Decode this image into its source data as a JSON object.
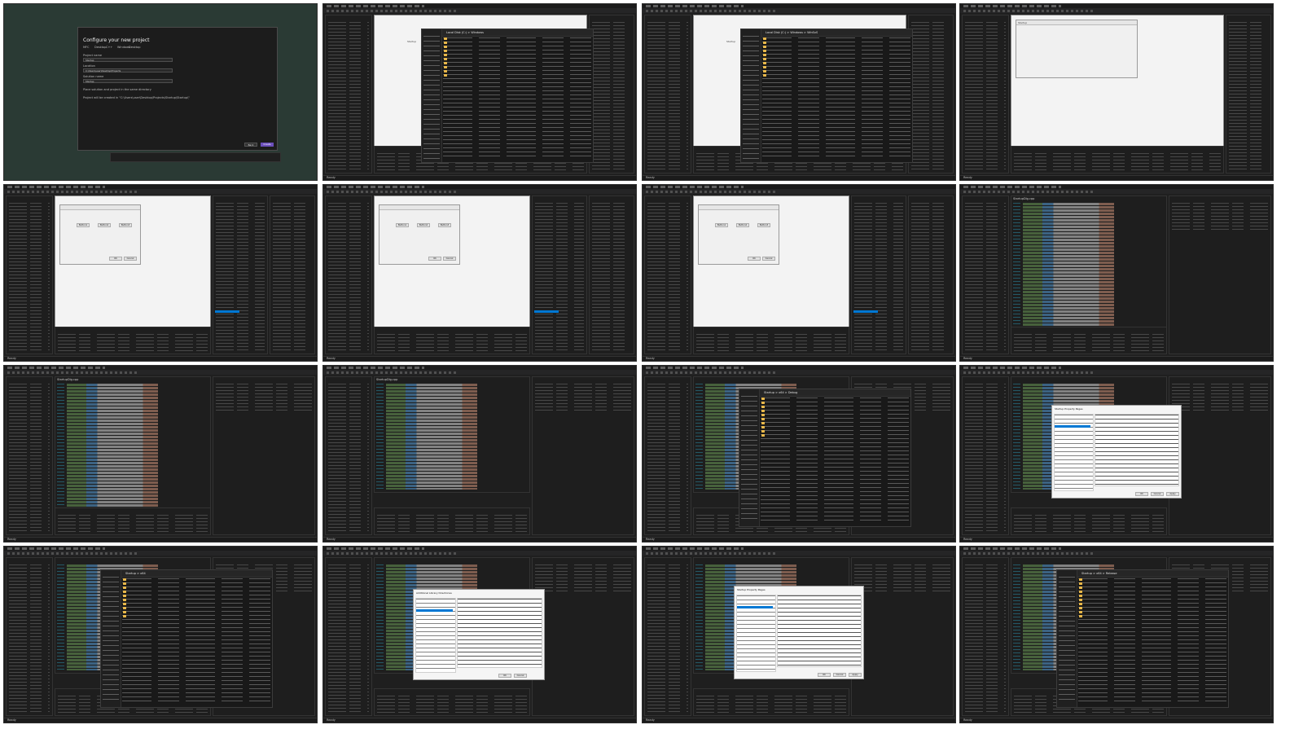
{
  "frames": [
    {
      "kind": "new-project",
      "dialog_title": "Configure your new project",
      "tags": [
        "MFC",
        "Desktop",
        "C++",
        "Windows",
        "Desktop"
      ],
      "fields": [
        {
          "label": "Project name",
          "value": "Startup"
        },
        {
          "label": "Location",
          "value": "C:\\Users\\user\\Desktop\\Projects"
        },
        {
          "label": "Solution name",
          "value": "Startup"
        }
      ],
      "checkbox": "Place solution and project in the same directory",
      "note": "Project will be created in \"C:\\Users\\user\\Desktop\\Projects\\Startup\\Startup\\\"",
      "back_label": "Back",
      "create_label": "Create"
    },
    {
      "kind": "vs-explorer",
      "status": "Ready",
      "explorer_path": "Local Disk (C:) > Windows"
    },
    {
      "kind": "vs-explorer",
      "status": "Ready",
      "explorer_path": "Local Disk (C:) > Windows > WinSxS"
    },
    {
      "kind": "vs-designer",
      "status": "Ready",
      "dialog_caption": "Startup"
    },
    {
      "kind": "vs-designer-props",
      "status": "Ready",
      "buttons": [
        "Button1",
        "Button2",
        "Button3"
      ],
      "ok": "OK",
      "cancel": "Cancel"
    },
    {
      "kind": "vs-designer-props",
      "status": "Ready",
      "buttons": [
        "Button1",
        "Button2",
        "Button3"
      ],
      "ok": "OK",
      "cancel": "Cancel"
    },
    {
      "kind": "vs-designer-props",
      "status": "Ready",
      "buttons": [
        "Button1",
        "Button2",
        "Button3"
      ],
      "ok": "OK",
      "cancel": "Cancel"
    },
    {
      "kind": "vs-code",
      "status": "Ready",
      "tab": "StartupDlg.cpp"
    },
    {
      "kind": "vs-code",
      "status": "Ready",
      "tab": "StartupDlg.cpp"
    },
    {
      "kind": "vs-code-output",
      "status": "Ready",
      "tab": "StartupDlg.cpp"
    },
    {
      "kind": "vs-explorer-code",
      "status": "Ready",
      "explorer_path": "Startup > x64 > Debug"
    },
    {
      "kind": "vs-property-pages",
      "status": "Ready",
      "dialog_title": "Startup Property Pages",
      "ok": "OK",
      "cancel": "Cancel",
      "apply": "Apply"
    },
    {
      "kind": "vs-explorer-code",
      "status": "Ready",
      "explorer_path": "Startup > x64"
    },
    {
      "kind": "vs-property-sheet",
      "status": "Ready",
      "dialog_title": "Additional Library Directories",
      "ok": "OK",
      "cancel": "Cancel"
    },
    {
      "kind": "vs-property-pages",
      "status": "Ready",
      "dialog_title": "Startup Property Pages",
      "ok": "OK",
      "cancel": "Cancel",
      "apply": "Apply"
    },
    {
      "kind": "vs-explorer-code",
      "status": "Ready",
      "explorer_path": "Startup > x64 > Release"
    }
  ],
  "colors": {
    "background": "#ffffff",
    "vs_dark": "#1f1f1f",
    "vs_accent": "#6b4fbb",
    "selection": "#0078d4",
    "folder": "#e8b84a"
  }
}
